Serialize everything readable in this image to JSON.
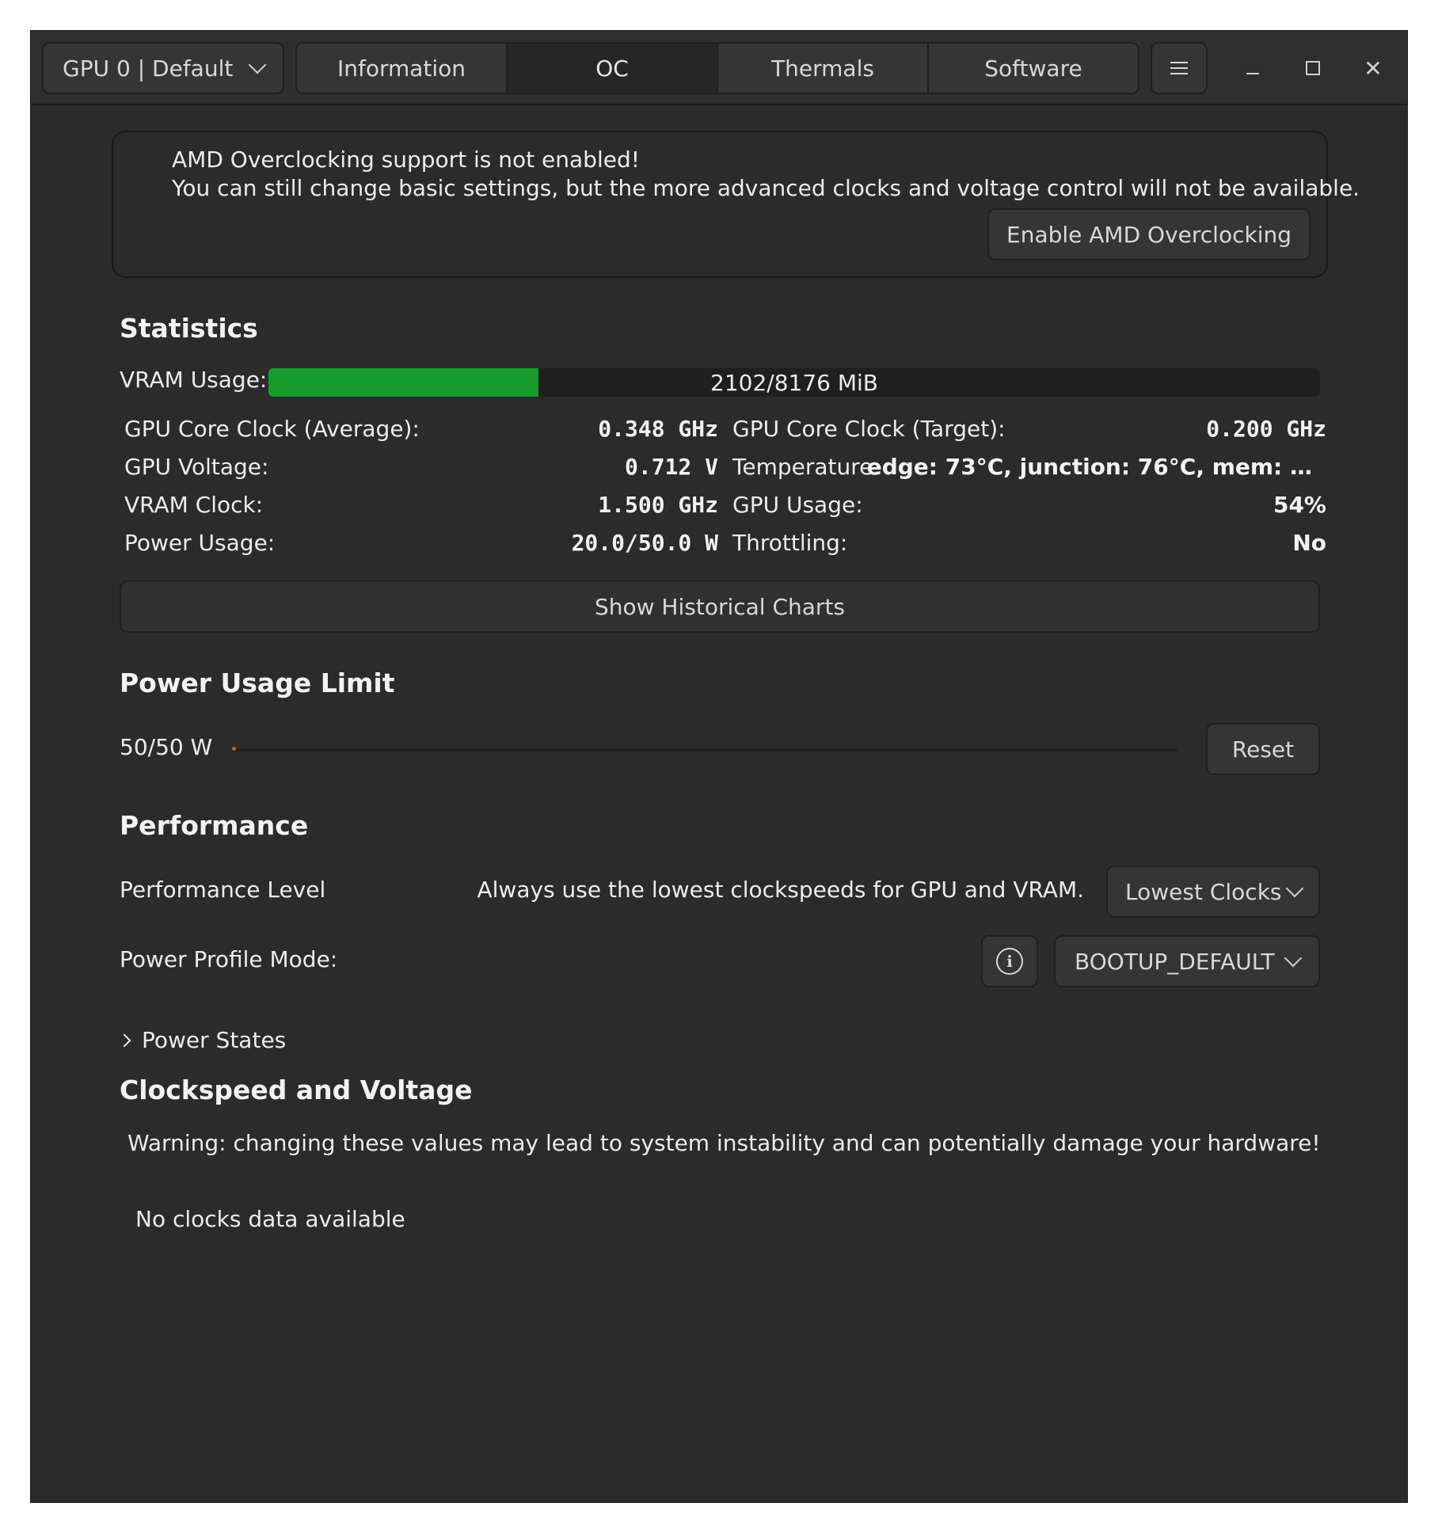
{
  "header": {
    "gpu_select": "GPU 0 | Default",
    "tabs": [
      {
        "label": "Information",
        "active": false
      },
      {
        "label": "OC",
        "active": true
      },
      {
        "label": "Thermals",
        "active": false
      },
      {
        "label": "Software",
        "active": false
      }
    ],
    "menu_icon": "hamburger-menu-icon",
    "window_controls": [
      "minimize-icon",
      "maximize-icon",
      "close-icon"
    ],
    "close_glyph": "✕"
  },
  "banner": {
    "line1": "AMD Overclocking support is not enabled!",
    "line2": "You can still change basic settings, but the more advanced clocks and voltage control will not be available.",
    "button": "Enable AMD Overclocking"
  },
  "statistics": {
    "title": "Statistics",
    "vram_label": "VRAM Usage:",
    "vram_text": "2102/8176 MiB",
    "vram_used": 2102,
    "vram_total": 8176,
    "vram_fill_color": "#169c2b",
    "left": [
      {
        "label": "GPU Core Clock (Average):",
        "value": "0.348 GHz"
      },
      {
        "label": "GPU Voltage:",
        "value": "0.712 V"
      },
      {
        "label": "VRAM Clock:",
        "value": "1.500 GHz"
      },
      {
        "label": "Power Usage:",
        "value": "20.0/50.0 W"
      }
    ],
    "right": [
      {
        "label": "GPU Core Clock (Target):",
        "value": "0.200 GHz"
      },
      {
        "label": "Temperature:",
        "value": "edge: 73°C, junction: 76°C, mem: …"
      },
      {
        "label": "GPU Usage:",
        "value": "54%"
      },
      {
        "label": "Throttling:",
        "value": "No"
      }
    ],
    "history_button": "Show Historical Charts"
  },
  "power_limit": {
    "title": "Power Usage Limit",
    "value_text": "50/50 W",
    "reset": "Reset",
    "accent": "#e05a00"
  },
  "performance": {
    "title": "Performance",
    "level_label": "Performance Level",
    "level_description": "Always use the lowest clockspeeds for GPU and VRAM.",
    "level_value": "Lowest Clocks",
    "mode_label": "Power Profile Mode:",
    "mode_value": "BOOTUP_DEFAULT",
    "info_icon": "info-icon",
    "info_glyph": "i",
    "power_states": "Power States"
  },
  "clocks": {
    "title": "Clockspeed and Voltage",
    "warning": "Warning: changing these values may lead to system instability and can potentially damage your hardware!",
    "empty": "No clocks data available"
  }
}
